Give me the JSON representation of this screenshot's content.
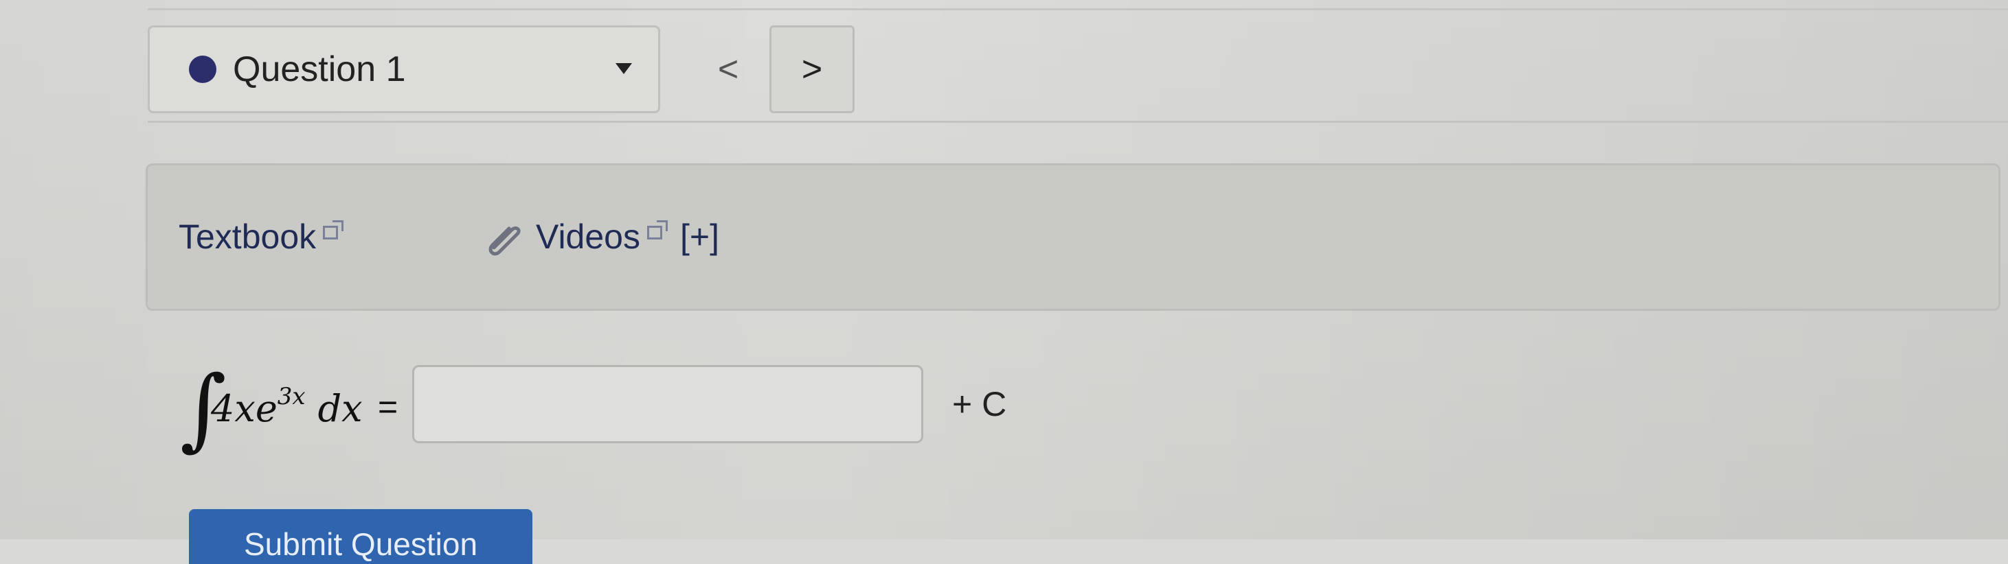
{
  "question_selector": {
    "label": "Question 1",
    "status_color": "#2c2d6b"
  },
  "navigation": {
    "prev_label": "<",
    "next_label": ">"
  },
  "resources": {
    "textbook_label": "Textbook",
    "videos_label": "Videos",
    "expand_label": "[+]",
    "icons": [
      "external-link-icon",
      "paperclip-icon"
    ]
  },
  "problem": {
    "integral_symbol": "∫",
    "coefficient": "4",
    "var": "x",
    "base": "e",
    "exponent": "3x",
    "differential": "dx",
    "equals": "=",
    "answer_value": "",
    "constant": "+ C"
  },
  "submit": {
    "label": "Submit Question",
    "color": "#2f65ae"
  }
}
